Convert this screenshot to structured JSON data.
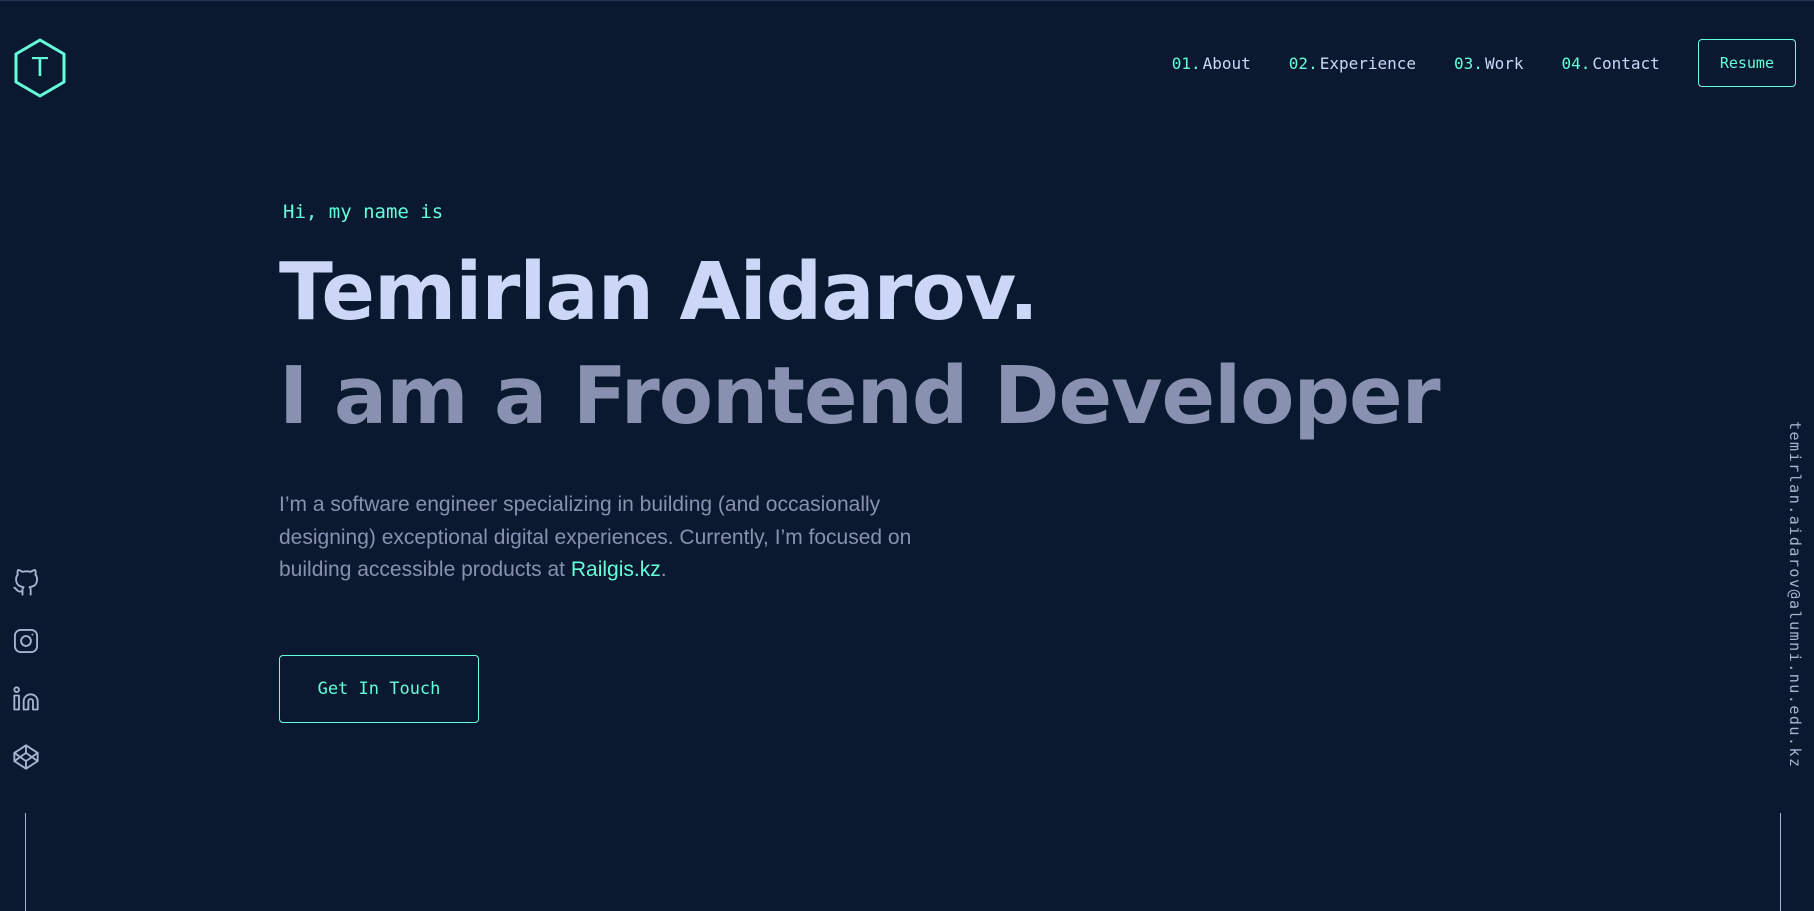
{
  "brand": {
    "logo_letter": "T",
    "accent_color": "#64ffda",
    "background_color": "#0a192f"
  },
  "nav": {
    "items": [
      {
        "num": "01.",
        "label": "About"
      },
      {
        "num": "02.",
        "label": "Experience"
      },
      {
        "num": "03.",
        "label": "Work"
      },
      {
        "num": "04.",
        "label": "Contact"
      }
    ],
    "resume_label": "Resume"
  },
  "hero": {
    "intro": "Hi, my name is",
    "name": "Temirlan Aidarov.",
    "role": "I am a Frontend Developer",
    "description_before": "I’m a software engineer specializing in building (and occasionally designing) exceptional digital experiences. Currently, I’m focused on building accessible products at ",
    "company": "Railgis.kz",
    "description_after": ".",
    "cta_label": "Get In Touch"
  },
  "social": {
    "icons": [
      "github-icon",
      "instagram-icon",
      "linkedin-icon",
      "codepen-icon"
    ]
  },
  "email": "temirlan.aidarov@alumni.nu.edu.kz"
}
